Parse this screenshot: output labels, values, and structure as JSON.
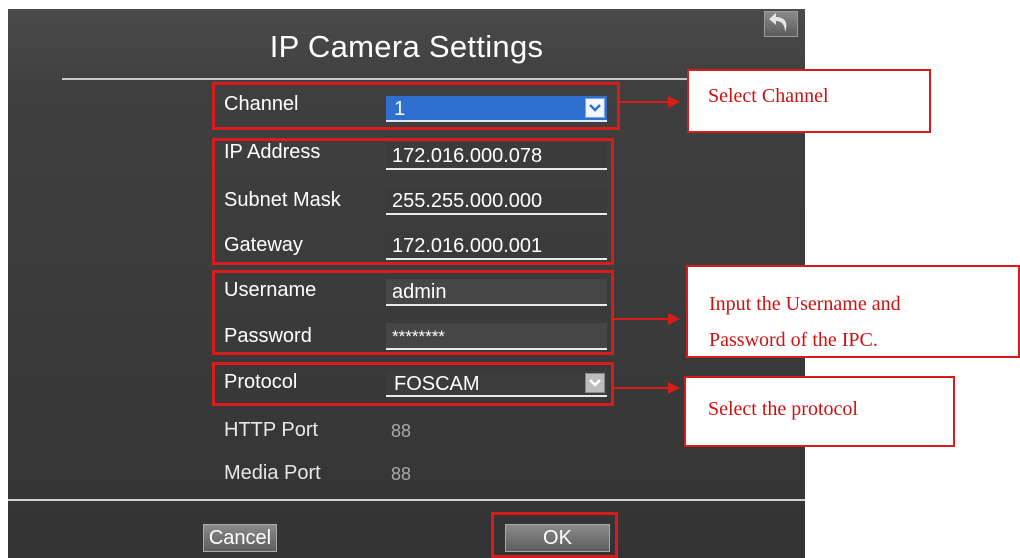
{
  "dialog": {
    "title": "IP Camera Settings",
    "back_icon": "back-arrow-icon"
  },
  "form": {
    "channel_label": "Channel",
    "channel_value": "1",
    "ip_label": "IP Address",
    "ip_value": "172.016.000.078",
    "subnet_label": "Subnet Mask",
    "subnet_value": "255.255.000.000",
    "gateway_label": "Gateway",
    "gateway_value": "172.016.000.001",
    "username_label": "Username",
    "username_value": "admin",
    "password_label": "Password",
    "password_value": "********",
    "protocol_label": "Protocol",
    "protocol_value": "FOSCAM",
    "http_port_label": "HTTP Port",
    "http_port_value": "88",
    "media_port_label": "Media Port",
    "media_port_value": "88"
  },
  "footer": {
    "cancel_label": "Cancel",
    "ok_label": "OK"
  },
  "annotations": {
    "select_channel": "Select Channel",
    "credentials_line1": "Input the Username and",
    "credentials_line2": "Password of the IPC.",
    "select_protocol": "Select the protocol"
  },
  "colors": {
    "highlight": "#d81c1c",
    "selected_dropdown": "#2f6fcf",
    "panel": "#3a3a3a"
  }
}
